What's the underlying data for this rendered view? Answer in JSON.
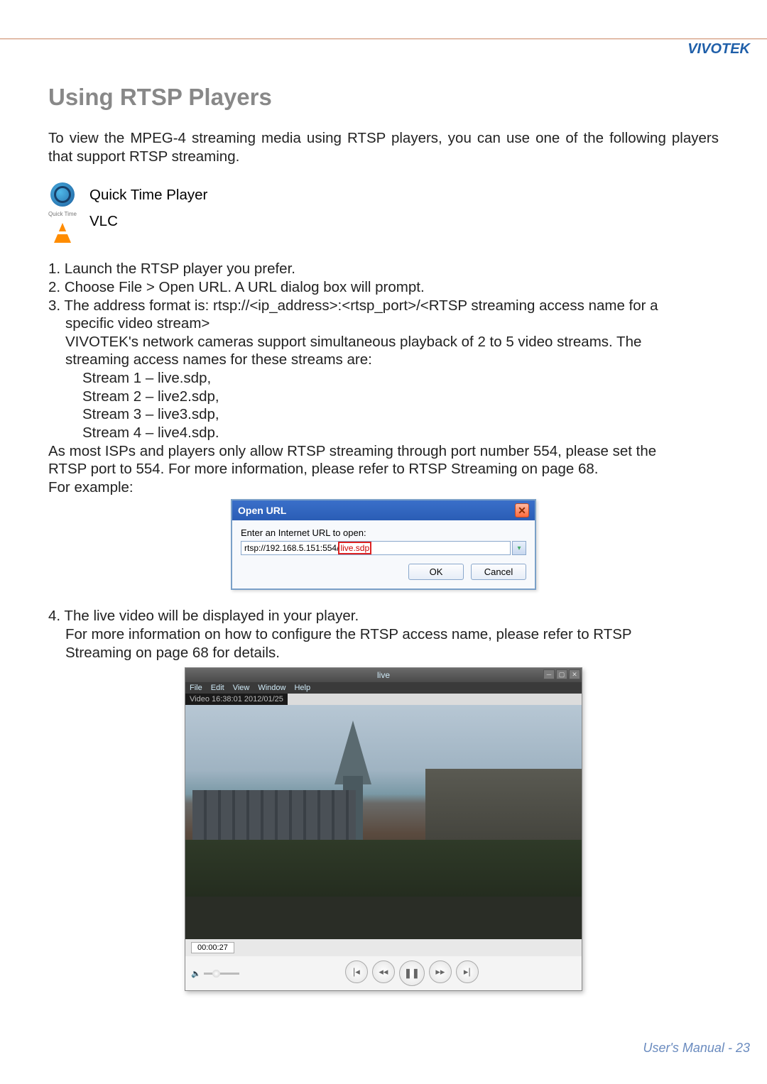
{
  "header": {
    "brand": "VIVOTEK"
  },
  "title": "Using RTSP Players",
  "intro": "To view the MPEG-4 streaming media using RTSP players, you can use one of the following players that support RTSP streaming.",
  "players": {
    "quicktime": "Quick Time Player",
    "vlc": "VLC",
    "qt_sub": "Quick Time"
  },
  "steps": {
    "s1": "1. Launch the RTSP player you prefer.",
    "s2": "2. Choose File > Open URL. A URL dialog box will prompt.",
    "s3a": "3. The address format is:  rtsp://<ip_address>:<rtsp_port>/<RTSP streaming access name for a",
    "s3b": "specific video stream>",
    "s3c": "VIVOTEK's network cameras support simultaneous playback of 2 to 5 video streams. The",
    "s3d": "streaming access names for these streams are:",
    "stream1": "Stream 1 – live.sdp,",
    "stream2": "Stream 2 – live2.sdp,",
    "stream3": "Stream 3 – live3.sdp,",
    "stream4": "Stream 4 – live4.sdp.",
    "isp1": "As most ISPs and players only allow RTSP streaming through port number 554, please set the",
    "isp2": "RTSP port to 554. For more information, please refer to RTSP Streaming on page 68.",
    "example_label": "For example:",
    "s4a": "4. The live video will be displayed in your player.",
    "s4b": "For more information on how to configure the RTSP access name, please refer to RTSP",
    "s4c": "Streaming on page 68 for details."
  },
  "dialog": {
    "title": "Open URL",
    "label": "Enter an Internet URL to open:",
    "url_prefix": "rtsp://192.168.5.151:554/",
    "url_highlight": "live.sdp",
    "ok": "OK",
    "cancel": "Cancel"
  },
  "player": {
    "title": "live",
    "menus": [
      "File",
      "Edit",
      "View",
      "Window",
      "Help"
    ],
    "overlay": "Video 16:38:01 2012/01/25",
    "time": "00:00:27"
  },
  "footer": {
    "label": "User's Manual",
    "page": "23"
  }
}
